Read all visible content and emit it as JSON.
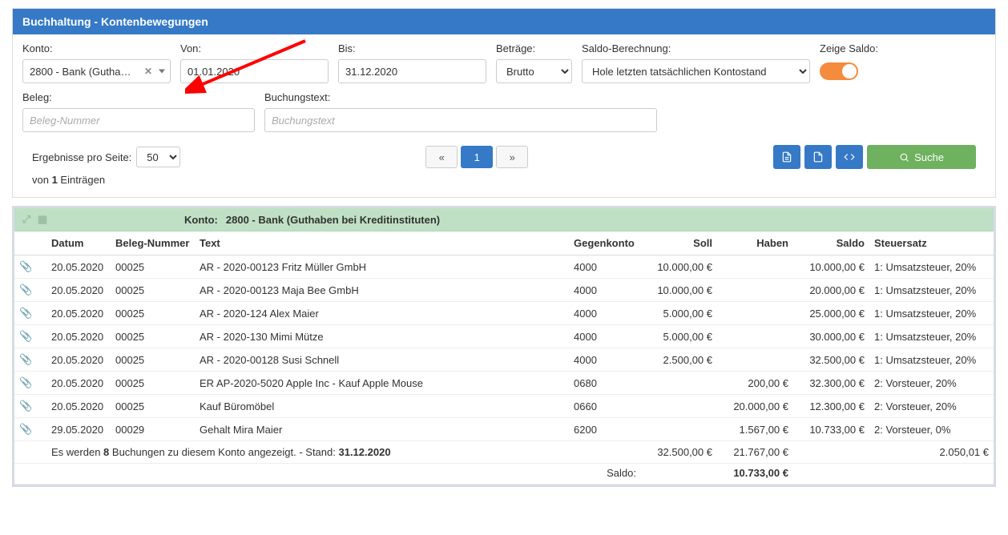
{
  "header": {
    "title": "Buchhaltung - Kontenbewegungen"
  },
  "filters": {
    "konto": {
      "label": "Konto:",
      "value": "2800 - Bank (Gutha…"
    },
    "von": {
      "label": "Von:",
      "value": "01.01.2020"
    },
    "bis": {
      "label": "Bis:",
      "value": "31.12.2020"
    },
    "betraege": {
      "label": "Beträge:",
      "value": "Brutto"
    },
    "saldoCalc": {
      "label": "Saldo-Berechnung:",
      "value": "Hole letzten tatsächlichen Kontostand"
    },
    "showSaldo": {
      "label": "Zeige Saldo:",
      "on": true
    },
    "beleg": {
      "label": "Beleg:",
      "placeholder": "Beleg-Nummer"
    },
    "btext": {
      "label": "Buchungstext:",
      "placeholder": "Buchungstext"
    }
  },
  "pagination": {
    "perPageLabel": "Ergebnisse pro Seite:",
    "perPage": "50",
    "infoPrefix": "von ",
    "infoCount": "1",
    "infoSuffix": " Einträgen",
    "prev": "«",
    "page": "1",
    "next": "»"
  },
  "actions": {
    "searchLabel": "Suche"
  },
  "group": {
    "label": "Konto:",
    "name": "2800 - Bank (Guthaben bei Kreditinstituten)"
  },
  "columns": {
    "datum": "Datum",
    "beleg": "Beleg-Nummer",
    "text": "Text",
    "gegen": "Gegenkonto",
    "soll": "Soll",
    "haben": "Haben",
    "saldo": "Saldo",
    "steuer": "Steuersatz"
  },
  "rows": [
    {
      "datum": "20.05.2020",
      "beleg": "00025",
      "text": "AR - 2020-00123 Fritz Müller GmbH",
      "gegen": "4000",
      "soll": "10.000,00 €",
      "haben": "",
      "saldo": "10.000,00 €",
      "steuer": "1: Umsatzsteuer, 20%"
    },
    {
      "datum": "20.05.2020",
      "beleg": "00025",
      "text": "AR - 2020-00123 Maja Bee GmbH",
      "gegen": "4000",
      "soll": "10.000,00 €",
      "haben": "",
      "saldo": "20.000,00 €",
      "steuer": "1: Umsatzsteuer, 20%"
    },
    {
      "datum": "20.05.2020",
      "beleg": "00025",
      "text": "AR - 2020-124 Alex Maier",
      "gegen": "4000",
      "soll": "5.000,00 €",
      "haben": "",
      "saldo": "25.000,00 €",
      "steuer": "1: Umsatzsteuer, 20%"
    },
    {
      "datum": "20.05.2020",
      "beleg": "00025",
      "text": "AR - 2020-130 Mimi Mütze",
      "gegen": "4000",
      "soll": "5.000,00 €",
      "haben": "",
      "saldo": "30.000,00 €",
      "steuer": "1: Umsatzsteuer, 20%"
    },
    {
      "datum": "20.05.2020",
      "beleg": "00025",
      "text": "AR - 2020-00128 Susi Schnell",
      "gegen": "4000",
      "soll": "2.500,00 €",
      "haben": "",
      "saldo": "32.500,00 €",
      "steuer": "1: Umsatzsteuer, 20%"
    },
    {
      "datum": "20.05.2020",
      "beleg": "00025",
      "text": "ER AP-2020-5020 Apple Inc - Kauf Apple Mouse",
      "gegen": "0680",
      "soll": "",
      "haben": "200,00 €",
      "saldo": "32.300,00 €",
      "steuer": "2: Vorsteuer, 20%"
    },
    {
      "datum": "20.05.2020",
      "beleg": "00025",
      "text": "Kauf Büromöbel",
      "gegen": "0660",
      "soll": "",
      "haben": "20.000,00 €",
      "saldo": "12.300,00 €",
      "steuer": "2: Vorsteuer, 20%"
    },
    {
      "datum": "29.05.2020",
      "beleg": "00029",
      "text": "Gehalt Mira Maier",
      "gegen": "6200",
      "soll": "",
      "haben": "1.567,00 €",
      "saldo": "10.733,00 €",
      "steuer": "2: Vorsteuer, 0%"
    }
  ],
  "footer": {
    "sumPre": "Es werden ",
    "sumCount": "8",
    "sumMid": " Buchungen zu diesem Konto angezeigt. - Stand: ",
    "sumDate": "31.12.2020",
    "sollTotal": "32.500,00 €",
    "habenTotal": "21.767,00 €",
    "steuerTotal": "2.050,01 €",
    "saldoLabel": "Saldo:",
    "saldoValue": "10.733,00 €"
  }
}
